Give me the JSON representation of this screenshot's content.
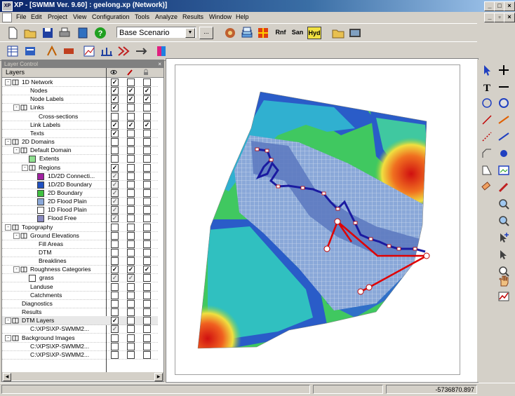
{
  "window": {
    "title": "XP - [SWMM Ver. 9.60] : geelong.xp (Network)]",
    "app_icon": "XP"
  },
  "menu": {
    "items": [
      "File",
      "Edit",
      "Project",
      "View",
      "Configuration",
      "Tools",
      "Analyze",
      "Results",
      "Window",
      "Help"
    ]
  },
  "toolbar": {
    "scenario": "Base Scenario",
    "browse": "...",
    "runoff": "Rnf",
    "sanitary": "San",
    "hydraulics": "Hyd"
  },
  "layers_panel": {
    "title": "Layer Control",
    "header": "Layers",
    "rows": [
      {
        "label": "1D Network"
      },
      {
        "label": "Nodes"
      },
      {
        "label": "Node Labels"
      },
      {
        "label": "Links"
      },
      {
        "label": "Cross-sections"
      },
      {
        "label": "Link Labels"
      },
      {
        "label": "Texts"
      },
      {
        "label": "2D Domains"
      },
      {
        "label": "Default Domain"
      },
      {
        "label": "Extents"
      },
      {
        "label": "Regions"
      },
      {
        "label": "1D/2D Connecti..."
      },
      {
        "label": "1D/2D Boundary"
      },
      {
        "label": "2D Boundary"
      },
      {
        "label": "2D Flood Plain"
      },
      {
        "label": "1D Flood Plain"
      },
      {
        "label": "Flood Free"
      },
      {
        "label": "Topography"
      },
      {
        "label": "Ground Elevations"
      },
      {
        "label": "Fill Areas"
      },
      {
        "label": "DTM"
      },
      {
        "label": "Breaklines"
      },
      {
        "label": "Roughness Categories"
      },
      {
        "label": "grass"
      },
      {
        "label": "Landuse"
      },
      {
        "label": "Catchments"
      },
      {
        "label": "Diagnostics"
      },
      {
        "label": "Results"
      },
      {
        "label": "DTM Layers"
      },
      {
        "label": "C:\\XPS\\XP-SWMM2..."
      },
      {
        "label": "Background Images"
      },
      {
        "label": "C:\\XPS\\XP-SWMM2..."
      },
      {
        "label": "C:\\XPS\\XP-SWMM2..."
      }
    ]
  },
  "status": {
    "coordinate": "-5736870.897"
  },
  "colors": {
    "title_start": "#0a246a",
    "title_end": "#a6caf0",
    "face": "#d4d0c8",
    "network": "#1a1aa0",
    "connection": "#e00000"
  }
}
